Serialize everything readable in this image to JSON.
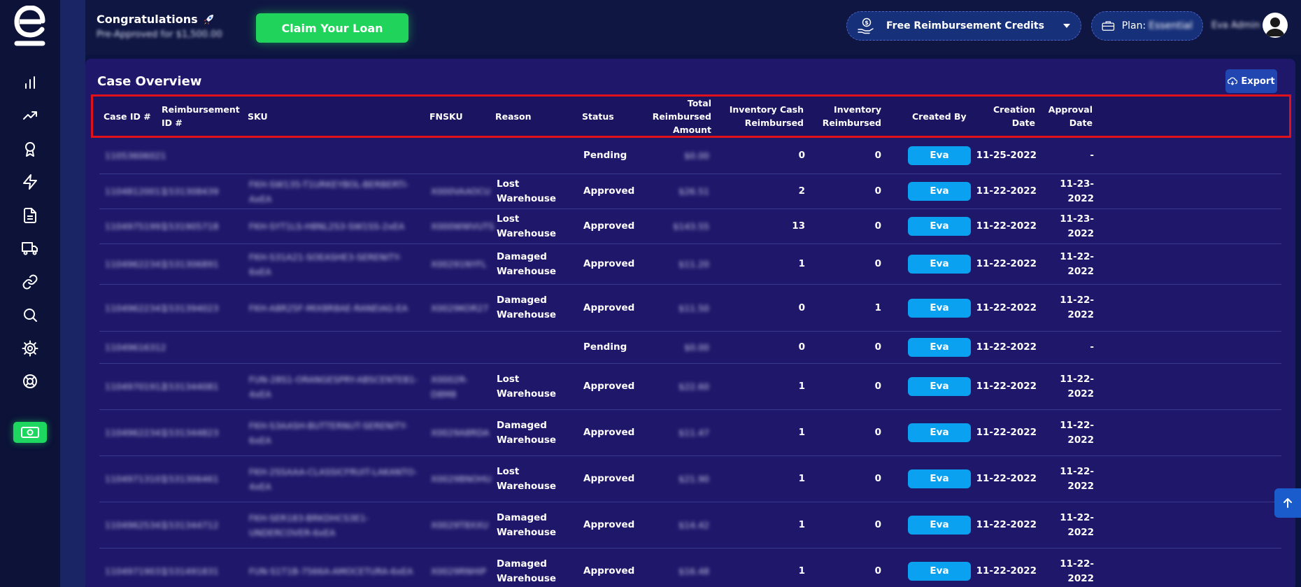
{
  "brand": {
    "logo_letter": "e"
  },
  "sidebar": {
    "items": [
      {
        "icon": "bar-chart-icon"
      },
      {
        "icon": "trending-up-icon"
      },
      {
        "icon": "award-icon"
      },
      {
        "icon": "lightning-icon"
      },
      {
        "icon": "document-icon"
      },
      {
        "icon": "truck-icon"
      },
      {
        "icon": "link-icon"
      },
      {
        "icon": "search-icon"
      },
      {
        "icon": "gear-icon"
      },
      {
        "icon": "lifebuoy-icon"
      }
    ],
    "cash_icon": "money-icon"
  },
  "header": {
    "congrats_title": "Congratulations",
    "congrats_sub": "Pre-Approved for $1,500.00",
    "claim_label": "Claim Your Loan",
    "credits_label": "Free Reimbursement Credits",
    "plan_label": "Plan:",
    "plan_value": "Essential",
    "user_name": "Eva Admin"
  },
  "colors": {
    "accent_green": "#20d35a",
    "badge_blue": "#0aa1f0",
    "highlight_red": "#e0111a",
    "panel": "#1f176a"
  },
  "panel": {
    "title": "Case Overview",
    "export_label": "Export"
  },
  "table": {
    "columns": [
      "Case ID #",
      "Reimbursement ID #",
      "SKU",
      "FNSKU",
      "Reason",
      "Status",
      "Total Reimbursed Amount",
      "Inventory Cash Reimbursed",
      "Inventory Reimbursed",
      "Created By",
      "Creation Date",
      "Approval Date"
    ],
    "rows": [
      {
        "case": "11053606021",
        "rid": "",
        "sku": "",
        "fnsku": "",
        "reason": "",
        "status": "Pending",
        "amount": "$0.00",
        "cash": "0",
        "inv": "0",
        "by": "Eva",
        "created": "11-25-2022",
        "approved": "-"
      },
      {
        "case": "11048120011",
        "rid": "1531308439",
        "sku": "FKH-SW135-T1URKEYBOL-BERBERTI-AxEA",
        "fnsku": "X000VAAOCU",
        "reason": "Lost Warehouse",
        "status": "Approved",
        "amount": "$26.51",
        "cash": "2",
        "inv": "0",
        "by": "Eva",
        "created": "11-22-2022",
        "approved": "11-23-2022"
      },
      {
        "case": "11049751991",
        "rid": "1531905718",
        "sku": "FKH-SYT1LS-H8NL2S3-SW1SS-2xEA",
        "fnsku": "X000WWVUTS",
        "reason": "Lost Warehouse",
        "status": "Approved",
        "amount": "$143.55",
        "cash": "13",
        "inv": "0",
        "by": "Eva",
        "created": "11-22-2022",
        "approved": "11-23-2022"
      },
      {
        "case": "11049622341",
        "rid": "1531306891",
        "sku": "FKH-S31A21-SOEASHE3-SERENITY-6xEA",
        "fnsku": "X00291NYFL",
        "reason": "Damaged Warehouse",
        "status": "Approved",
        "amount": "$11.20",
        "cash": "1",
        "inv": "0",
        "by": "Eva",
        "created": "11-22-2022",
        "approved": "11-22-2022"
      },
      {
        "case": "11049622341",
        "rid": "1531394023",
        "sku": "FKH-A8R25F-MIX8R8AE-RANEIAG-EA",
        "fnsku": "X0029KOR27",
        "reason": "Damaged Warehouse",
        "status": "Approved",
        "amount": "$11.50",
        "cash": "0",
        "inv": "1",
        "by": "Eva",
        "created": "11-22-2022",
        "approved": "11-22-2022"
      },
      {
        "case": "11049616312",
        "rid": "",
        "sku": "",
        "fnsku": "",
        "reason": "",
        "status": "Pending",
        "amount": "$0.00",
        "cash": "0",
        "inv": "0",
        "by": "Eva",
        "created": "11-22-2022",
        "approved": "-"
      },
      {
        "case": "11049701912",
        "rid": "1531344081",
        "sku": "FUN-28S1-ORANGESPRY-ABSCENTEB1-4xEA",
        "fnsku": "X0002R-D8M8",
        "reason": "Lost Warehouse",
        "status": "Approved",
        "amount": "$22.60",
        "cash": "1",
        "inv": "0",
        "by": "Eva",
        "created": "11-22-2022",
        "approved": "11-22-2022"
      },
      {
        "case": "11049622341",
        "rid": "1531344823",
        "sku": "FKH-S3AASH-BUTTERNUT-SERENITY-6xEA",
        "fnsku": "X0029A8RDA",
        "reason": "Damaged Warehouse",
        "status": "Approved",
        "amount": "$11.47",
        "cash": "1",
        "inv": "0",
        "by": "Eva",
        "created": "11-22-2022",
        "approved": "11-22-2022"
      },
      {
        "case": "11049713101",
        "rid": "1531306461",
        "sku": "FKH-2SSAAA-CLASSICFRUIT-LAKANTO-4xEA",
        "fnsku": "X0029BNOHU",
        "reason": "Lost Warehouse",
        "status": "Approved",
        "amount": "$21.90",
        "cash": "1",
        "inv": "0",
        "by": "Eva",
        "created": "11-22-2022",
        "approved": "11-22-2022"
      },
      {
        "case": "11049625341",
        "rid": "1531344712",
        "sku": "FKH-SER183-BRKDHCS3E1-UNDERCOVER-6xEA",
        "fnsku": "X0029T8XXU",
        "reason": "Damaged Warehouse",
        "status": "Approved",
        "amount": "$14.42",
        "cash": "1",
        "inv": "0",
        "by": "Eva",
        "created": "11-22-2022",
        "approved": "11-22-2022"
      },
      {
        "case": "11049719031",
        "rid": "1531491831",
        "sku": "FUN-S1T1B-7566A-AMOCETURA-6xEA",
        "fnsku": "X0029RNHIP",
        "reason": "Damaged Warehouse",
        "status": "Approved",
        "amount": "$16.48",
        "cash": "1",
        "inv": "0",
        "by": "Eva",
        "created": "11-22-2022",
        "approved": "11-22-2022"
      }
    ]
  }
}
